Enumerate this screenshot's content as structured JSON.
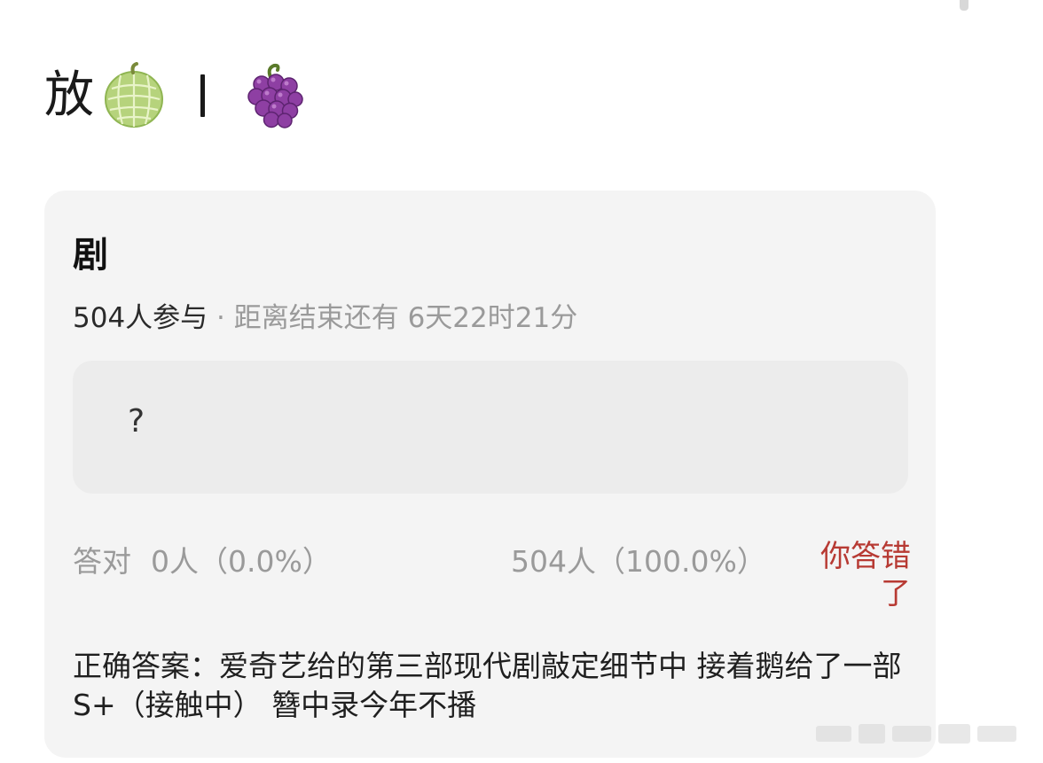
{
  "post": {
    "title_text": "放",
    "icons": [
      "melon-emoji",
      "grape-emoji"
    ]
  },
  "poll": {
    "title": "剧",
    "participants": "504人参与",
    "separator": " · ",
    "time_left": "距离结束还有 6天22时21分",
    "question": "?",
    "correct_label": "答对",
    "correct_stat": "0人（0.0%）",
    "other_stat": "504人（100.0%）",
    "your_result": "你答错了",
    "answer": "正确答案：爱奇艺给的第三部现代剧敲定细节中 接着鹅给了一部S+（接触中） 簪中录今年不播"
  },
  "colors": {
    "wrong_red": "#b73a33",
    "card_bg": "#f4f4f4",
    "question_bg": "#ececec",
    "muted_text": "#9a9a9a"
  }
}
